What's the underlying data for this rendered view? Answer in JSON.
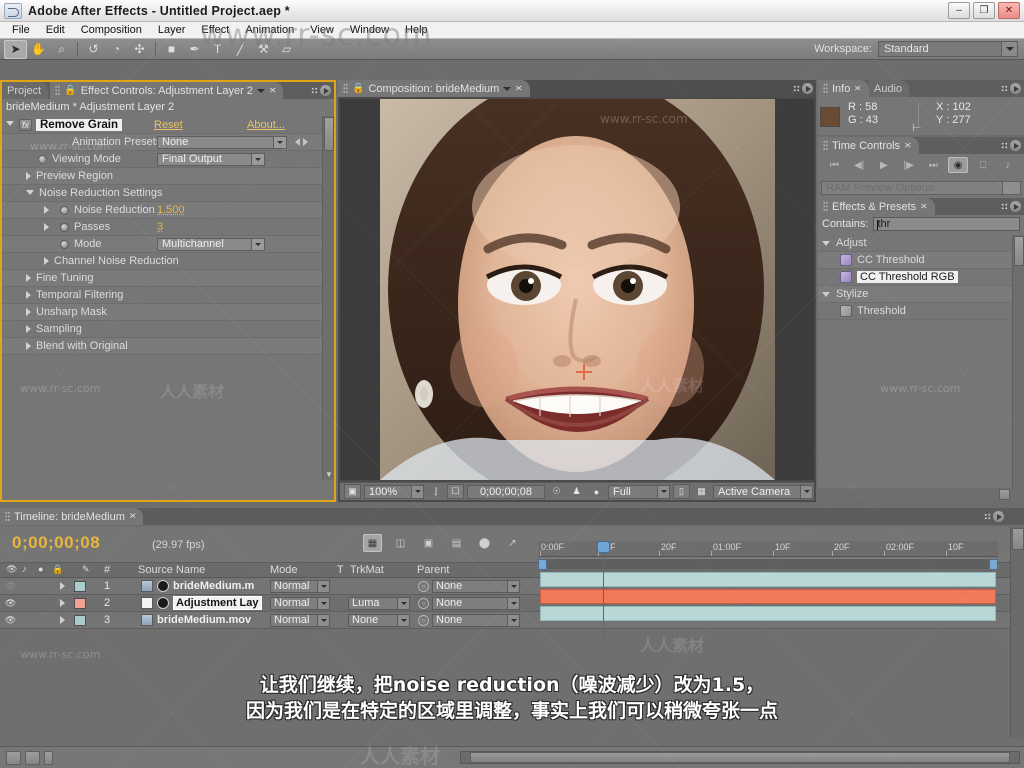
{
  "window": {
    "title": "Adobe After Effects - Untitled Project.aep *",
    "minimize_label": "–",
    "restore_label": "❐",
    "close_label": "✕"
  },
  "menu": {
    "items": [
      "File",
      "Edit",
      "Composition",
      "Layer",
      "Effect",
      "Animation",
      "View",
      "Window",
      "Help"
    ]
  },
  "toolbar": {
    "tools": [
      {
        "name": "selection-tool",
        "glyph": "➤"
      },
      {
        "name": "hand-tool",
        "glyph": "✋"
      },
      {
        "name": "zoom-tool",
        "glyph": "⌕"
      },
      {
        "name": "rotation-tool",
        "glyph": "↺"
      },
      {
        "name": "camera-tool",
        "glyph": "◔"
      },
      {
        "name": "pan-behind-tool",
        "glyph": "✣"
      },
      {
        "name": "shape-tool",
        "glyph": "■"
      },
      {
        "name": "pen-tool",
        "glyph": "✒"
      },
      {
        "name": "type-tool",
        "glyph": "T"
      },
      {
        "name": "brush-tool",
        "glyph": "╱"
      },
      {
        "name": "clone-stamp-tool",
        "glyph": "⚒"
      },
      {
        "name": "eraser-tool",
        "glyph": "▱"
      }
    ],
    "workspace_label": "Workspace:",
    "workspace_value": "Standard"
  },
  "effect_controls": {
    "tab_project": "Project",
    "tab_active": "Effect Controls: Adjustment Layer 2",
    "header": "brideMedium * Adjustment Layer 2",
    "effect_name": "Remove Grain",
    "reset": "Reset",
    "about": "About...",
    "rows": [
      {
        "label": "Animation Presets:",
        "value": "None",
        "kind": "combo"
      },
      {
        "label": "Viewing Mode",
        "value": "Final Output",
        "kind": "combo"
      },
      {
        "label": "Preview Region",
        "value": "",
        "kind": "group"
      },
      {
        "label": "Noise Reduction Settings",
        "value": "",
        "kind": "group-open"
      },
      {
        "label": "Noise Reduction",
        "value": "1.500",
        "kind": "value"
      },
      {
        "label": "Passes",
        "value": "3",
        "kind": "value"
      },
      {
        "label": "Mode",
        "value": "Multichannel",
        "kind": "combo"
      },
      {
        "label": "Channel Noise Reduction",
        "value": "",
        "kind": "subgroup"
      },
      {
        "label": "Fine Tuning",
        "value": "",
        "kind": "group"
      },
      {
        "label": "Temporal Filtering",
        "value": "",
        "kind": "group"
      },
      {
        "label": "Unsharp Mask",
        "value": "",
        "kind": "group"
      },
      {
        "label": "Sampling",
        "value": "",
        "kind": "group"
      },
      {
        "label": "Blend with Original",
        "value": "",
        "kind": "group"
      }
    ]
  },
  "composition": {
    "tab_label": "Composition: brideMedium",
    "zoom": "100%",
    "timecode": "0;00;00;08",
    "resolution": "Full",
    "view": "Active Camera"
  },
  "info": {
    "tab_label": "Info",
    "tab_audio": "Audio",
    "r": "R : 58",
    "g": "G : 43",
    "x": "X : 102",
    "y": "Y : 277",
    "swatch_color": "#6a4b34"
  },
  "time_controls": {
    "tab_label": "Time Controls",
    "buttons": [
      "first-frame",
      "prev-frame",
      "play",
      "next-frame",
      "last-frame",
      "ram-preview",
      "loop",
      "audio"
    ],
    "ram_preview_options": "RAM Preview Options"
  },
  "effects_presets": {
    "tab_label": "Effects & Presets",
    "contains_label": "Contains:",
    "contains_value": "thr",
    "groups": [
      {
        "name": "Adjust",
        "items": [
          {
            "label": "CC Threshold",
            "selected": false
          },
          {
            "label": "CC Threshold RGB",
            "selected": true
          }
        ]
      },
      {
        "name": "Stylize",
        "items": [
          {
            "label": "Threshold",
            "selected": false
          }
        ]
      }
    ]
  },
  "timeline": {
    "tab_label": "Timeline: brideMedium",
    "timecode": "0;00;00;08",
    "fps": "(29.97 fps)",
    "columns": [
      "#",
      "Source Name",
      "Mode",
      "T",
      "TrkMat",
      "Parent"
    ],
    "ruler_ticks": [
      "0:00F",
      "10F",
      "20F",
      "01:00F",
      "10F",
      "20F",
      "02:00F",
      "10F"
    ],
    "layers": [
      {
        "index": "1",
        "source_name": "brideMedium.m",
        "mode": "Normal",
        "trkmat": "",
        "parent": "None",
        "selected": false,
        "bar_color": "#b9d7d7",
        "label_color": "#a9cccc",
        "visible": false
      },
      {
        "index": "2",
        "source_name": "Adjustment Lay",
        "mode": "Normal",
        "trkmat": "Luma",
        "parent": "None",
        "selected": true,
        "bar_color": "#f0795a",
        "label_color": "#f2a294",
        "visible": true
      },
      {
        "index": "3",
        "source_name": "brideMedium.mov",
        "mode": "Normal",
        "trkmat": "None",
        "parent": "None",
        "selected": false,
        "bar_color": "#b9d7d7",
        "label_color": "#a9cccc",
        "visible": true
      }
    ]
  },
  "subtitle": {
    "line1": "让我们继续，把noise reduction（噪波减少）改为1.5，",
    "line2": "因为我们是在特定的区域里调整，事实上我们可以稍微夸张一点"
  },
  "watermark": {
    "url": "www.rr-sc.com",
    "cn": "人人素材"
  },
  "colors": {
    "accent_orange": "#e0a417",
    "value_orange": "#e8b34a",
    "timecode_yellow": "#e9b53c",
    "panel_bg": "#767676",
    "selection_red": "#d23b2a"
  }
}
